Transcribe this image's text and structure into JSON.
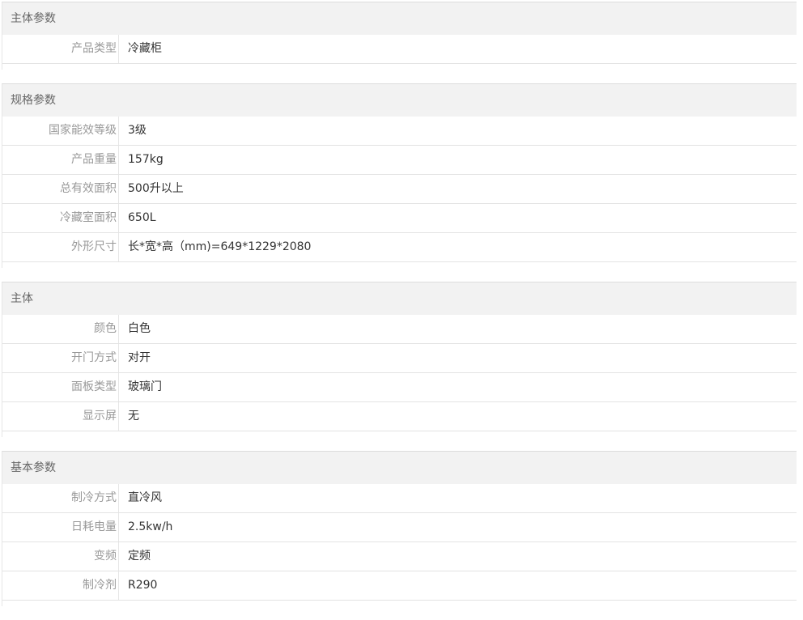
{
  "sections": [
    {
      "title": "主体参数",
      "rows": [
        {
          "label": "产品类型",
          "value": "冷藏柜"
        }
      ]
    },
    {
      "title": "规格参数",
      "rows": [
        {
          "label": "国家能效等级",
          "value": "3级"
        },
        {
          "label": "产品重量",
          "value": "157kg"
        },
        {
          "label": "总有效面积",
          "value": "500升以上"
        },
        {
          "label": "冷藏室面积",
          "value": "650L"
        },
        {
          "label": "外形尺寸",
          "value": "长*宽*高（mm)=649*1229*2080"
        }
      ]
    },
    {
      "title": "主体",
      "rows": [
        {
          "label": "颜色",
          "value": "白色"
        },
        {
          "label": "开门方式",
          "value": "对开"
        },
        {
          "label": "面板类型",
          "value": "玻璃门"
        },
        {
          "label": "显示屏",
          "value": "无"
        }
      ]
    },
    {
      "title": "基本参数",
      "rows": [
        {
          "label": "制冷方式",
          "value": "直冷风"
        },
        {
          "label": "日耗电量",
          "value": "2.5kw/h"
        },
        {
          "label": "变频",
          "value": "定频"
        },
        {
          "label": "制冷剂",
          "value": "R290"
        }
      ]
    }
  ]
}
